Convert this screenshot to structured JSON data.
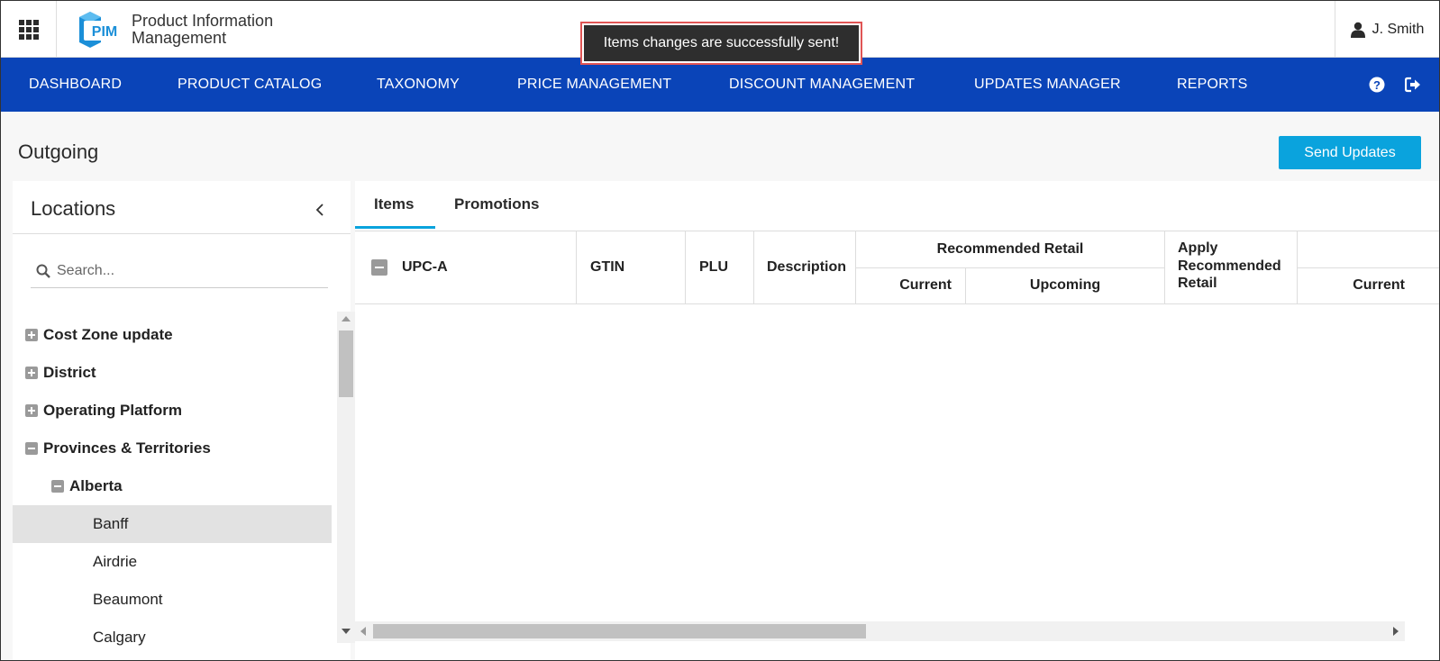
{
  "app": {
    "logo_badge": "PIM",
    "title_line1": "Product Information",
    "title_line2": "Management"
  },
  "user": {
    "name": "J. Smith",
    "icon": "user-icon"
  },
  "toast": {
    "message": "Items changes are successfully sent!"
  },
  "nav": {
    "items": [
      {
        "label": "DASHBOARD"
      },
      {
        "label": "PRODUCT CATALOG"
      },
      {
        "label": "TAXONOMY"
      },
      {
        "label": "PRICE MANAGEMENT"
      },
      {
        "label": "DISCOUNT MANAGEMENT"
      },
      {
        "label": "UPDATES MANAGER"
      },
      {
        "label": "REPORTS"
      }
    ],
    "help_icon": "help-icon",
    "logout_icon": "logout-icon"
  },
  "page": {
    "title": "Outgoing",
    "send_button": "Send Updates"
  },
  "locations": {
    "title": "Locations",
    "search_placeholder": "Search...",
    "tree": [
      {
        "label": "Cost Zone update",
        "state": "collapsed"
      },
      {
        "label": "District",
        "state": "collapsed"
      },
      {
        "label": "Operating Platform",
        "state": "collapsed"
      },
      {
        "label": "Provinces & Territories",
        "state": "expanded"
      },
      {
        "label": "Alberta",
        "state": "expanded"
      },
      {
        "label": "Banff",
        "selected": true
      },
      {
        "label": "Airdrie"
      },
      {
        "label": "Beaumont"
      },
      {
        "label": "Calgary"
      }
    ]
  },
  "tabs": [
    {
      "label": "Items",
      "active": true
    },
    {
      "label": "Promotions"
    }
  ],
  "table": {
    "headers": {
      "upca": "UPC-A",
      "gtin": "GTIN",
      "plu": "PLU",
      "description": "Description",
      "recommended_retail": "Recommended Retail",
      "current": "Current",
      "upcoming": "Upcoming",
      "apply_line1": "Apply",
      "apply_line2": "Recommended",
      "apply_line3": "Retail",
      "current2": "Current"
    },
    "rows": []
  },
  "colors": {
    "nav_bg": "#0a44b8",
    "accent": "#0aa3dd",
    "toast_bg": "#2e2e2e",
    "toast_border": "#e05555"
  }
}
